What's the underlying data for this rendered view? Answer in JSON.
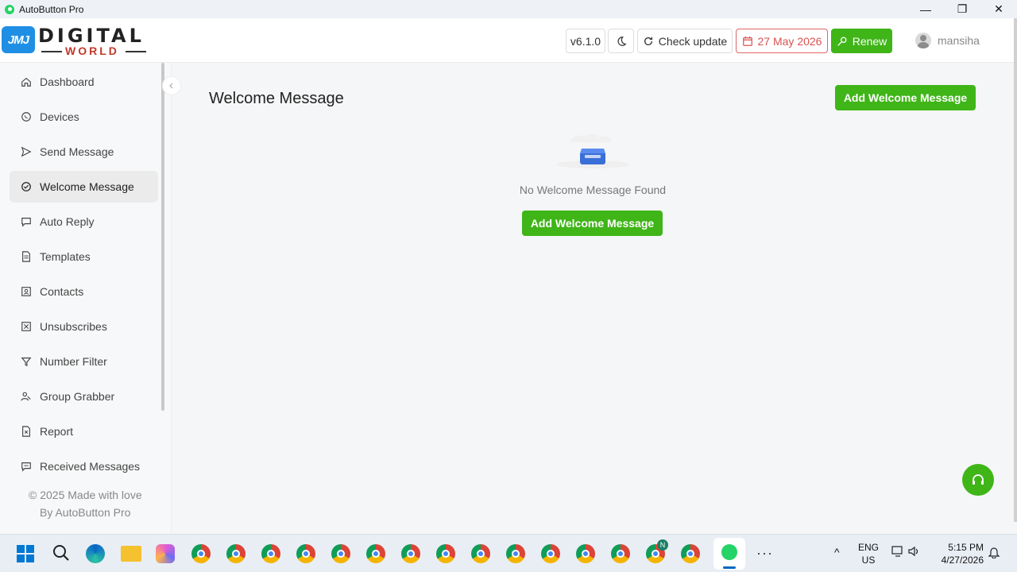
{
  "window": {
    "title": "AutoButton Pro",
    "minimize": "—",
    "maximize": "❐",
    "close": "✕"
  },
  "logo": {
    "badge": "JMJ",
    "line1": "DIGITAL",
    "line2": "WORLD"
  },
  "header": {
    "version": "v6.1.0",
    "check_update": "Check update",
    "expiry_date": "27 May 2026",
    "renew": "Renew",
    "username": "mansiha"
  },
  "sidebar": {
    "items": [
      {
        "label": "Dashboard",
        "icon": "home-icon"
      },
      {
        "label": "Devices",
        "icon": "whatsapp-icon"
      },
      {
        "label": "Send Message",
        "icon": "send-icon"
      },
      {
        "label": "Welcome Message",
        "icon": "welcome-icon",
        "active": true
      },
      {
        "label": "Auto Reply",
        "icon": "chat-icon"
      },
      {
        "label": "Templates",
        "icon": "document-icon"
      },
      {
        "label": "Contacts",
        "icon": "contact-card-icon"
      },
      {
        "label": "Unsubscribes",
        "icon": "unsubscribe-icon"
      },
      {
        "label": "Number Filter",
        "icon": "filter-icon"
      },
      {
        "label": "Group Grabber",
        "icon": "group-icon"
      },
      {
        "label": "Report",
        "icon": "report-icon"
      },
      {
        "label": "Received Messages",
        "icon": "inbox-icon"
      }
    ],
    "footer_line1": "© 2025 Made with love",
    "footer_line2": "By AutoButton Pro"
  },
  "main": {
    "title": "Welcome Message",
    "add_button": "Add Welcome Message",
    "empty_text": "No Welcome Message Found",
    "empty_button": "Add Welcome Message"
  },
  "taskbar": {
    "lang1": "ENG",
    "lang2": "US",
    "time": "5:15 PM",
    "date": "4/27/2026",
    "badge": "N",
    "dots": "···",
    "up": "^"
  },
  "colors": {
    "accent_green": "#3fb518",
    "date_red": "#d9534f"
  }
}
